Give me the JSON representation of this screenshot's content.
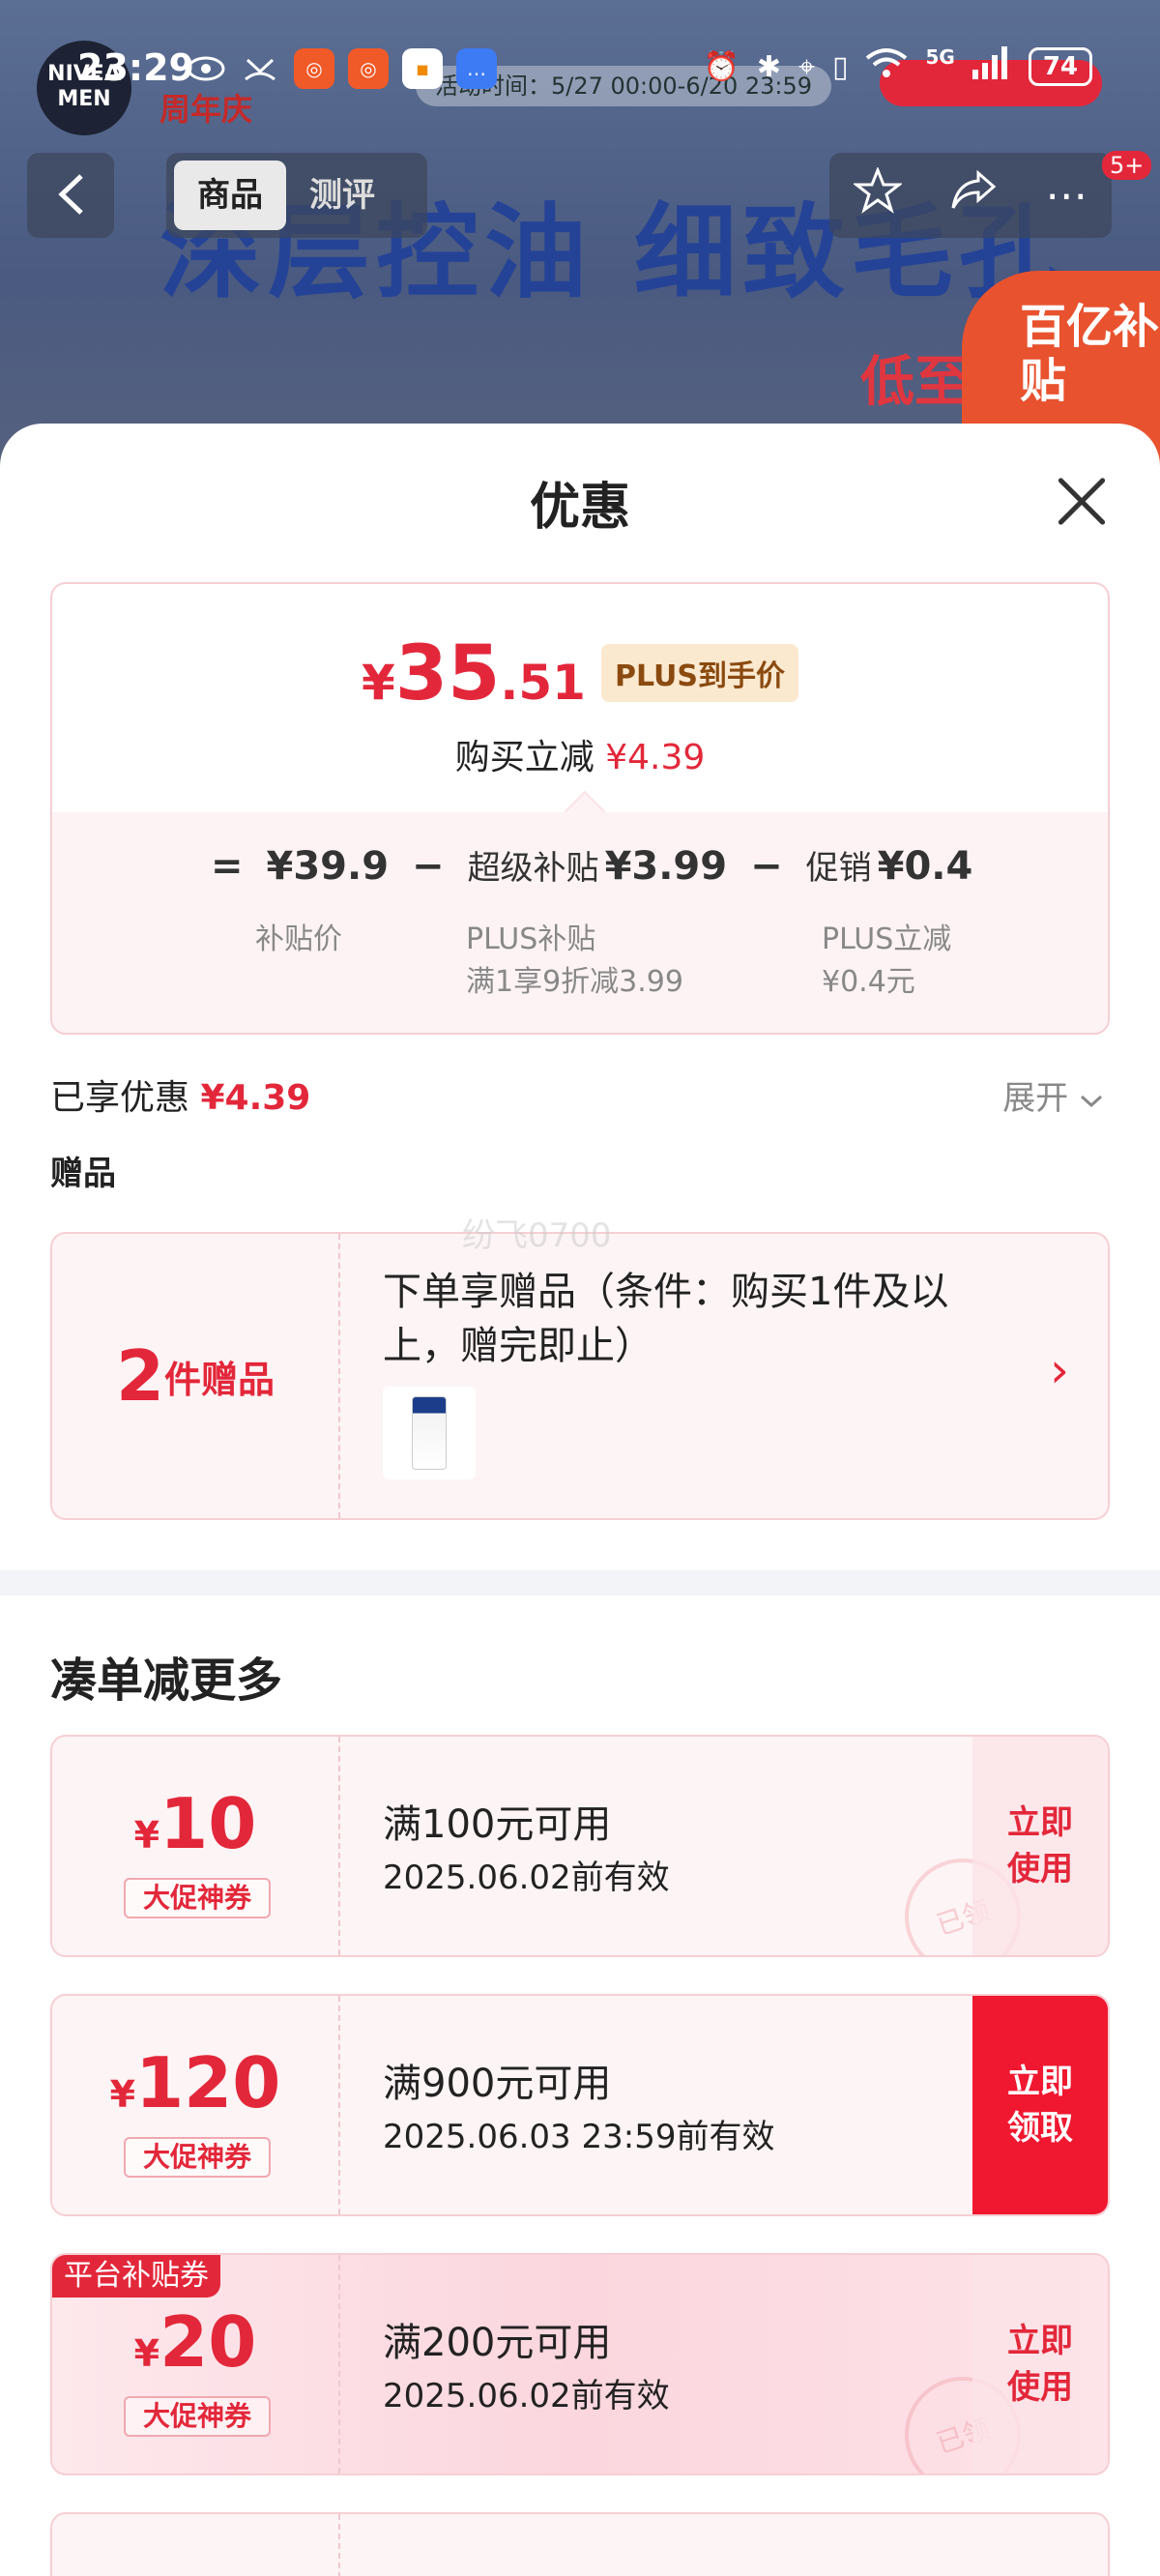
{
  "status_bar": {
    "time": "23:29",
    "network": "5G",
    "battery": "74"
  },
  "background": {
    "logo": "NIVEA MEN",
    "anniversary": "周年庆",
    "activity_time": "活动时间：5/27 00:00-6/20 23:59",
    "banner_text": "深层控油 细致毛孔",
    "subsidy_badge": "百亿补贴",
    "lowest_text": "低至4折"
  },
  "nav": {
    "back_icon": "chevron-left-icon",
    "tabs": [
      {
        "label": "商品",
        "active": true
      },
      {
        "label": "测评",
        "active": false
      }
    ],
    "badge": "5+"
  },
  "sheet": {
    "title": "优惠",
    "price": {
      "symbol": "¥",
      "integer": "35",
      "decimal": ".51",
      "plus_tag": "PLUS到手价",
      "reduce_label": "购买立减",
      "reduce_amount": "¥4.39"
    },
    "formula": {
      "eq": "=",
      "base": "¥39.9",
      "minus1": "−",
      "super_label": "超级补贴",
      "super_amount": "¥3.99",
      "minus2": "−",
      "promo_label": "促销",
      "promo_amount": "¥0.4",
      "base_caption": "补贴价",
      "super_caption_1": "PLUS补贴",
      "super_caption_2": "满1享9折减3.99",
      "promo_caption_1": "PLUS立减",
      "promo_caption_2": "¥0.4元"
    },
    "enjoyed_label": "已享优惠",
    "enjoyed_amount": "¥4.39",
    "expand_label": "展开",
    "gift_heading": "赠品",
    "gift": {
      "count": "2",
      "count_unit": "件赠品",
      "description": "下单享赠品（条件：购买1件及以上，赠完即止）"
    },
    "watermark": "纷飞0700",
    "section_title": "凑单减更多",
    "coupons": [
      {
        "symbol": "¥",
        "amount": "10",
        "tag": "大促神券",
        "condition": "满100元可用",
        "validity": "2025.06.02前有效",
        "action": "立即使用",
        "stamp": "已领",
        "solid": false,
        "platform_tag": ""
      },
      {
        "symbol": "¥",
        "amount": "120",
        "tag": "大促神券",
        "condition": "满900元可用",
        "validity": "2025.06.03 23:59前有效",
        "action": "立即领取",
        "stamp": "",
        "solid": true,
        "platform_tag": ""
      },
      {
        "symbol": "¥",
        "amount": "20",
        "tag": "大促神券",
        "condition": "满200元可用",
        "validity": "2025.06.02前有效",
        "action": "立即使用",
        "stamp": "已领",
        "solid": false,
        "platform_tag": "平台补贴券"
      }
    ]
  },
  "colors": {
    "accent": "#e3273a",
    "sheet_bg": "#ffffff",
    "card_bg": "#fdf4f5"
  }
}
